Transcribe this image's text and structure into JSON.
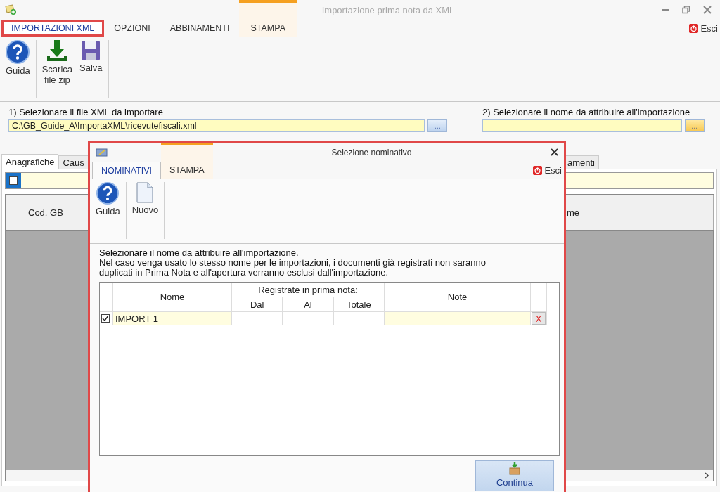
{
  "window": {
    "title": "Importazione prima nota da XML"
  },
  "ribbon_tabs": [
    {
      "label": "IMPORTAZIONI XML",
      "selected": true,
      "kind": "normal"
    },
    {
      "label": "OPZIONI",
      "selected": false,
      "kind": "normal"
    },
    {
      "label": "ABBINAMENTI",
      "selected": false,
      "kind": "normal"
    },
    {
      "label": "STAMPA",
      "selected": false,
      "kind": "contextual"
    }
  ],
  "exit": "Esci",
  "ribbon_groups": [
    [
      {
        "label": "Guida",
        "kind": "help"
      }
    ],
    [
      {
        "label": "Scarica\nfile zip",
        "kind": "download"
      },
      {
        "label": "Salva",
        "kind": "save"
      }
    ]
  ],
  "file_section": {
    "label": "1) Selezionare il file XML da importare",
    "value": "C:\\GB_Guide_A\\ImportaXML\\ricevutefiscali.xml",
    "browse": "..."
  },
  "name_section": {
    "label": "2) Selezionare il nome da attribuire all'importazione",
    "browse": "..."
  },
  "data_tabs": [
    {
      "label": "Anagrafiche",
      "selected": true
    },
    {
      "label": "Caus",
      "selected": false
    },
    {
      "label": "amenti",
      "selected": false
    }
  ],
  "select_all": {
    "checked": false
  },
  "grid_columns": [
    "Cod. GB",
    "me"
  ],
  "dialog": {
    "title": "Selezione nominativo",
    "tabs": [
      {
        "label": "NOMINATIVI",
        "selected": true,
        "kind": "normal"
      },
      {
        "label": "STAMPA",
        "selected": false,
        "kind": "contextual"
      }
    ],
    "exit": "Esci",
    "tools": [
      {
        "label": "Guida",
        "kind": "help"
      },
      {
        "label": "Nuovo",
        "kind": "new"
      }
    ],
    "instructions": [
      "Selezionare il nome da attribuire all'importazione.",
      "Nel caso venga usato lo stesso nome per le importazioni, i documenti già registrati non saranno duplicati in Prima Nota e all'apertura verranno esclusi dall'importazione."
    ],
    "table": {
      "group_header": "Registrate in prima nota:",
      "name": "Nome",
      "from": "Dal",
      "to": "Al",
      "total": "Totale",
      "note": "Note",
      "rows": [
        {
          "checked": true,
          "name": "IMPORT 1",
          "delete": "X"
        }
      ]
    },
    "continue": "Continua"
  }
}
